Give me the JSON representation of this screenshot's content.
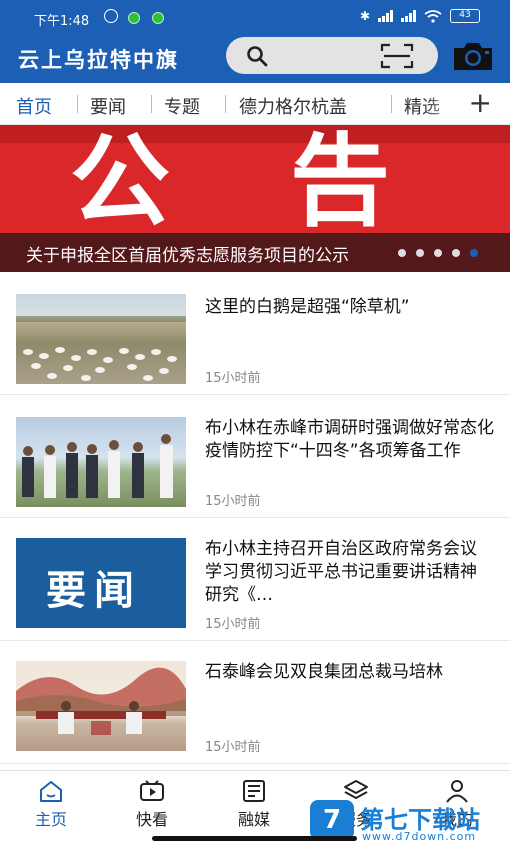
{
  "status_bar": {
    "time": "下午1:48",
    "battery": "43"
  },
  "header": {
    "app_title": "云上乌拉特中旗",
    "accent_color": "#1c5fb4"
  },
  "tabs": [
    {
      "label": "首页",
      "active": true
    },
    {
      "label": "要闻",
      "active": false
    },
    {
      "label": "专题",
      "active": false
    },
    {
      "label": "德力格尔杭盖",
      "active": false
    },
    {
      "label": "精选",
      "active": false
    }
  ],
  "tabs_add_icon": "plus-icon",
  "banner": {
    "headline": "公告",
    "caption": "关于申报全区首届优秀志愿服务项目的公示",
    "slide_count": 5,
    "current_slide": 5
  },
  "news": [
    {
      "title": "这里的白鹅是超强“除草机”",
      "time": "15小时前",
      "thumb": "geese-photo"
    },
    {
      "title": "布小林在赤峰市调研时强调做好常态化疫情防控下“十四冬”各项筹备工作",
      "time": "15小时前",
      "thumb": "officials-photo"
    },
    {
      "title": "布小林主持召开自治区政府常务会议  学习贯彻习近平总书记重要讲话精神  研究《…",
      "time": "15小时前",
      "thumb": "yaowen-graphic",
      "thumb_text": "要闻"
    },
    {
      "title": "石泰峰会见双良集团总裁马培林",
      "time": "15小时前",
      "thumb": "meeting-photo"
    }
  ],
  "bottom_nav": [
    {
      "label": "主页",
      "icon": "home-icon",
      "active": true
    },
    {
      "label": "快看",
      "icon": "video-icon",
      "active": false
    },
    {
      "label": "融媒",
      "icon": "newspaper-icon",
      "active": false
    },
    {
      "label": "服务",
      "icon": "layers-icon",
      "active": false
    },
    {
      "label": "我的",
      "icon": "user-icon",
      "active": false
    }
  ],
  "watermark": {
    "badge": "7",
    "name": "第七下载站",
    "url": "www.d7down.com"
  }
}
